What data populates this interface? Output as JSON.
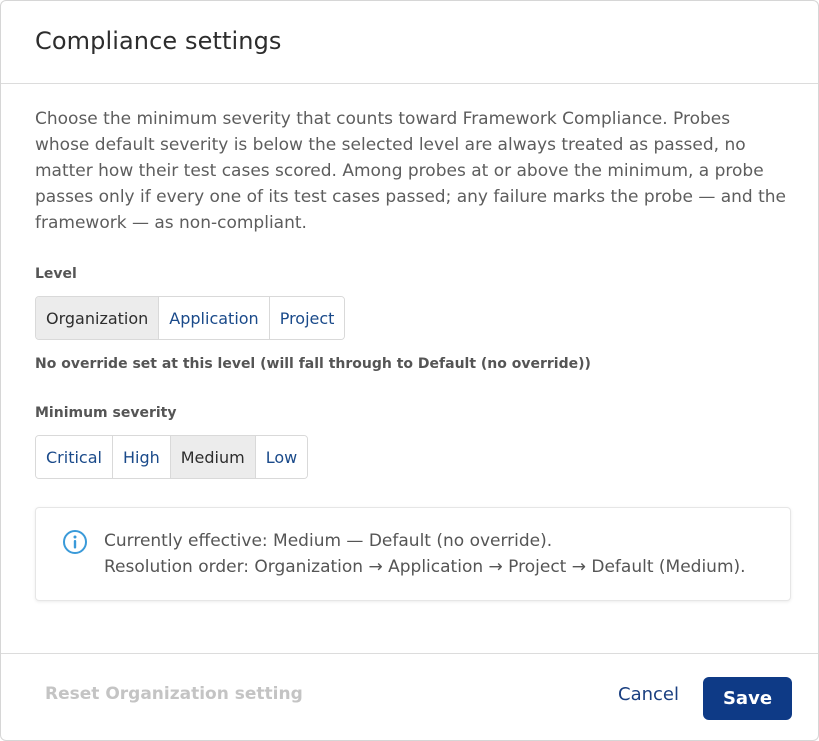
{
  "dialog": {
    "title": "Compliance settings",
    "description": "Choose the minimum severity that counts toward Framework Compliance. Probes whose default severity is below the selected level are always treated as passed, no matter how their test cases scored. Among probes at or above the minimum, a probe passes only if every one of its test cases passed; any failure marks the probe — and the framework — as non-compliant."
  },
  "level": {
    "label": "Level",
    "options": [
      "Organization",
      "Application",
      "Project"
    ],
    "selected": "Organization",
    "override_note": "No override set at this level (will fall through to Default (no override))"
  },
  "severity": {
    "label": "Minimum severity",
    "options": [
      "Critical",
      "High",
      "Medium",
      "Low"
    ],
    "selected": "Medium"
  },
  "info": {
    "icon": "info-icon",
    "line1": "Currently effective: Medium — Default (no override).",
    "line2": "Resolution order: Organization → Application → Project → Default (Medium)."
  },
  "footer": {
    "reset_label": "Reset Organization setting",
    "cancel_label": "Cancel",
    "save_label": "Save"
  },
  "colors": {
    "primary": "#0e3a86",
    "link": "#1a4a8a",
    "info_icon": "#3a9ad9",
    "selected_bg": "#ececec",
    "disabled_text": "#c4c4c4"
  }
}
